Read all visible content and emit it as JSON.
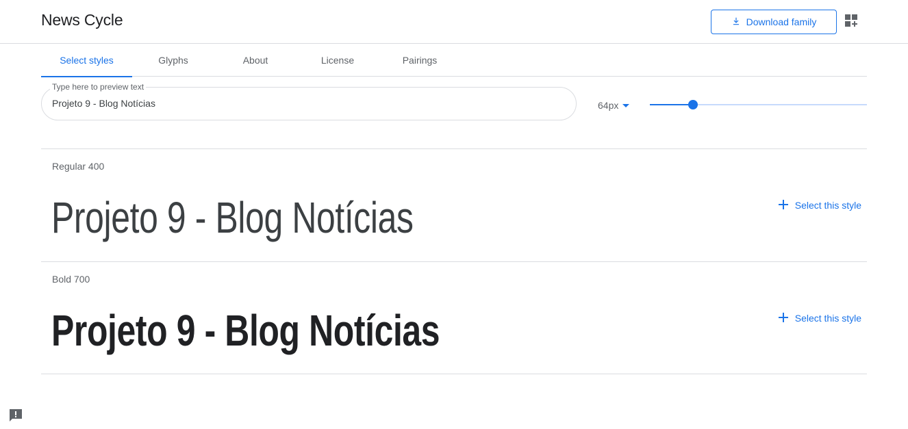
{
  "header": {
    "family_name": "News Cycle",
    "download_label": "Download family",
    "download_icon": "download-icon",
    "selected_family_icon": "apps-add-icon"
  },
  "tabs": [
    {
      "label": "Select styles",
      "active": true
    },
    {
      "label": "Glyphs",
      "active": false
    },
    {
      "label": "About",
      "active": false
    },
    {
      "label": "License",
      "active": false
    },
    {
      "label": "Pairings",
      "active": false
    }
  ],
  "preview": {
    "label": "Type here to preview text",
    "value": "Projeto 9 - Blog Notícias"
  },
  "size": {
    "value": "64px",
    "slider_fraction": 0.2
  },
  "styles": [
    {
      "name": "Regular 400",
      "sample": "Projeto 9 - Blog Notícias",
      "action": "Select this style"
    },
    {
      "name": "Bold 700",
      "sample": "Projeto 9 - Blog Notícias",
      "action": "Select this style"
    }
  ],
  "colors": {
    "accent": "#1a73e8",
    "divider": "#dadce0",
    "muted_text": "#5f6368"
  },
  "feedback_icon": "feedback-icon"
}
